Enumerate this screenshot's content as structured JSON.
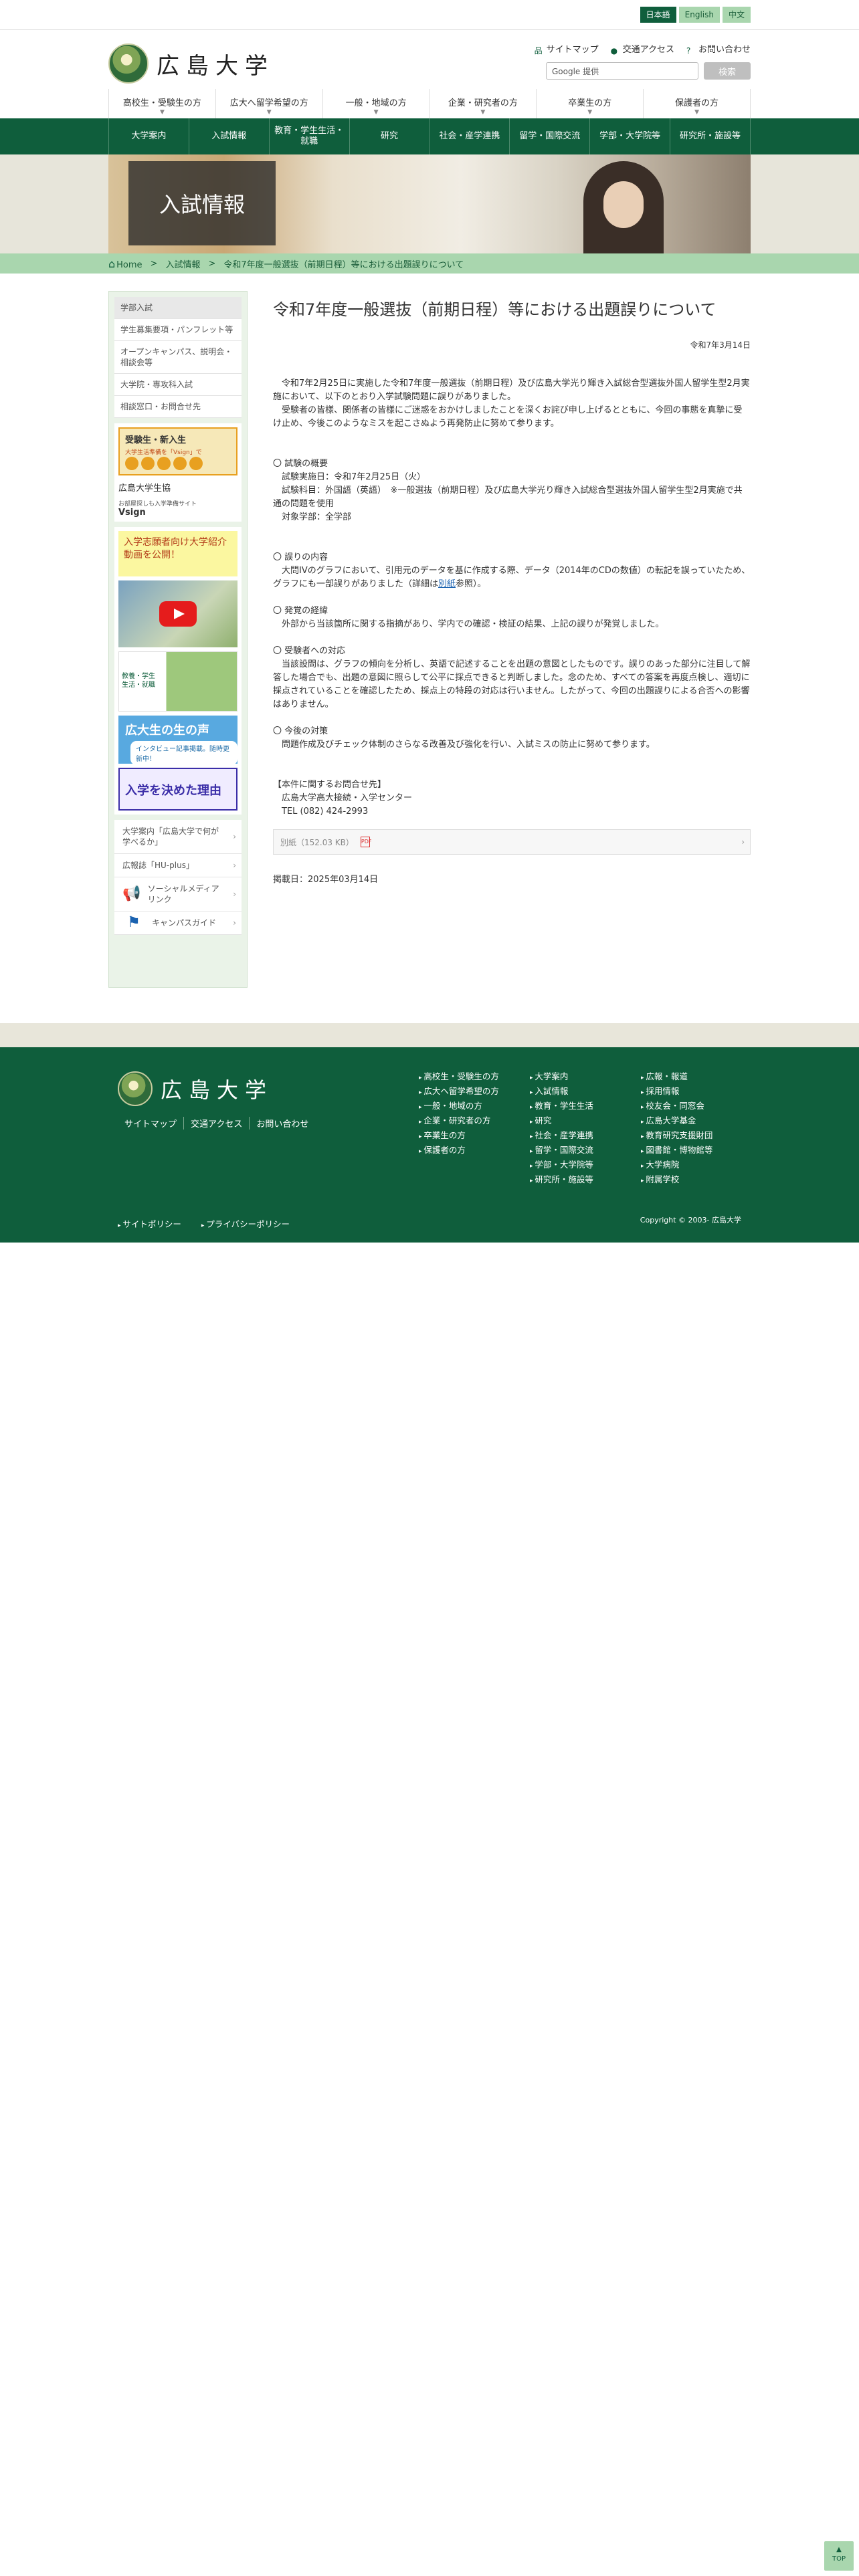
{
  "lang": {
    "ja": "日本語",
    "en": "English",
    "zh": "中文"
  },
  "header": {
    "logo_text": "広島大学",
    "links": [
      "サイトマップ",
      "交通アクセス",
      "お問い合わせ"
    ],
    "search_placeholder": "Google 提供",
    "search_button": "検索"
  },
  "audience_nav": [
    "高校生・受験生の方",
    "広大へ留学希望の方",
    "一般・地域の方",
    "企業・研究者の方",
    "卒業生の方",
    "保護者の方"
  ],
  "main_nav": [
    "大学案内",
    "入試情報",
    "教育・学生生活・就職",
    "研究",
    "社会・産学連携",
    "留学・国際交流",
    "学部・大学院等",
    "研究所・施設等"
  ],
  "hero": {
    "title": "入試情報"
  },
  "breadcrumb": [
    "Home",
    "入試情報",
    "令和7年度一般選抜（前期日程）等における出題誤りについて"
  ],
  "sidebar": {
    "menu": [
      "学部入試",
      "学生募集要項・パンフレット等",
      "オープンキャンパス、説明会・相談会等",
      "大学院・専攻科入試",
      "相談窓口・お問合せ先"
    ],
    "banner1_title": "受験生・新入生",
    "banner1_sub": "大学生活準備を「Vsign」で",
    "site_title": "広島大学生協",
    "site_sub": "お部屋探しも入学準備サイト",
    "site_logo": "Vsign",
    "video_head": "入学志願者向け大学紹介動画を公開！",
    "mag_label": "教養・学生生活・就職",
    "blue_banner": "広大生の生の声",
    "blue_banner_sub": "インタビュー記事掲載。随時更新中！",
    "purple_banner": "入学を決めた理由",
    "links": [
      "大学案内「広島大学で何が学べるか」",
      "広報誌「HU-plus」",
      "ソーシャルメディアリンク",
      "キャンパスガイド"
    ]
  },
  "article": {
    "title": "令和7年度一般選抜（前期日程）等における出題誤りについて",
    "date": "令和7年3月14日",
    "p1": "令和7年2月25日に実施した令和7年度一般選抜（前期日程）及び広島大学光り輝き入試総合型選抜外国人留学生型2月実施において、以下のとおり入学試験問題に誤りがありました。",
    "p2": "受験者の皆様、関係者の皆様にご迷惑をおかけしましたことを深くお詫び申し上げるとともに、今回の事態を真摯に受け止め、今後このようなミスを起こさぬよう再発防止に努めて参ります。",
    "s1_head": "〇 試験の概要",
    "s1_l1": "試験実施日：令和7年2月25日（火）",
    "s1_l2": "試験科目：外国語（英語）　※一般選抜（前期日程）及び広島大学光り輝き入試総合型選抜外国人留学生型2月実施で共通の問題を使用",
    "s1_l3": "対象学部：全学部",
    "s2_head": "〇 誤りの内容",
    "s2_body_a": "大問IVのグラフにおいて、引用元のデータを基に作成する際、データ（2014年のCDの数値）の転記を誤っていたため、グラフにも一部誤りがありました（詳細は",
    "s2_link": "別紙",
    "s2_body_b": "参照）。",
    "s3_head": "〇 発覚の経緯",
    "s3_body": "外部から当該箇所に関する指摘があり、学内での確認・検証の結果、上記の誤りが発覚しました。",
    "s4_head": "〇 受験者への対応",
    "s4_body": "当該設問は、グラフの傾向を分析し、英語で記述することを出題の意図としたものです。誤りのあった部分に注目して解答した場合でも、出題の意図に照らして公平に採点できると判断しました。念のため、すべての答案を再度点検し、適切に採点されていることを確認したため、採点上の特段の対応は行いません。したがって、今回の出題誤りによる合否への影響はありません。",
    "s5_head": "〇 今後の対策",
    "s5_body": "問題作成及びチェック体制のさらなる改善及び強化を行い、入試ミスの防止に努めて参ります。",
    "contact_head": "【本件に関するお問合せ先】",
    "contact_l1": "広島大学高大接続・入学センター",
    "contact_l2": "TEL (082) 424-2993",
    "attachment": "別紙（152.03 KB）",
    "posted": "掲載日：2025年03月14日"
  },
  "footer": {
    "logo_text": "広島大学",
    "links": [
      "サイトマップ",
      "交通アクセス",
      "お問い合わせ"
    ],
    "col1": [
      "高校生・受験生の方",
      "広大へ留学希望の方",
      "一般・地域の方",
      "企業・研究者の方",
      "卒業生の方",
      "保護者の方"
    ],
    "col2": [
      "大学案内",
      "入試情報",
      "教育・学生生活",
      "研究",
      "社会・産学連携",
      "留学・国際交流",
      "学部・大学院等",
      "研究所・施設等"
    ],
    "col3": [
      "広報・報道",
      "採用情報",
      "校友会・同窓会",
      "広島大学基金",
      "教育研究支援財団",
      "図書館・博物館等",
      "大学病院",
      "附属学校"
    ],
    "policy": [
      "サイトポリシー",
      "プライバシーポリシー"
    ],
    "copyright": "Copyright © 2003- 広島大学"
  },
  "totop": "TOP"
}
